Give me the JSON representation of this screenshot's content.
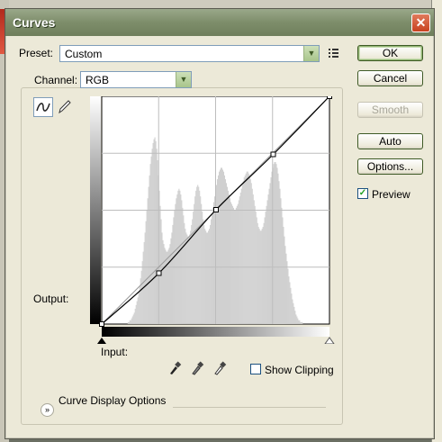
{
  "dialog": {
    "title": "Curves",
    "close_symbol": "✕",
    "preset_label": "Preset:",
    "preset_value": "Custom",
    "preset_menu_icon": "preset-options-icon",
    "channel_label": "Channel:",
    "channel_value": "RGB",
    "output_label": "Output:",
    "input_label": "Input:",
    "show_clipping_label": "Show Clipping",
    "show_clipping_checked": false,
    "curve_display_options_label": "Curve Display Options",
    "preview_label": "Preview",
    "preview_checked": true
  },
  "buttons": {
    "ok": "OK",
    "cancel": "Cancel",
    "smooth": "Smooth",
    "auto": "Auto",
    "options": "Options..."
  },
  "curve": {
    "points": [
      [
        0,
        0
      ],
      [
        64,
        57
      ],
      [
        128,
        128
      ],
      [
        192,
        190
      ],
      [
        255,
        255
      ]
    ]
  },
  "histogram": {
    "bins": [
      0,
      0,
      0,
      0,
      0,
      0,
      0,
      0,
      0,
      0,
      0,
      0,
      0,
      0,
      0,
      0,
      0,
      0,
      0,
      0,
      0,
      0,
      0,
      0,
      0,
      0,
      0,
      0,
      0,
      1,
      1,
      2,
      2,
      3,
      4,
      5,
      6,
      8,
      10,
      12,
      14,
      17,
      20,
      24,
      28,
      33,
      38,
      43,
      48,
      54,
      60,
      66,
      72,
      78,
      84,
      88,
      92,
      95,
      97,
      98,
      96,
      92,
      86,
      78,
      70,
      62,
      55,
      48,
      44,
      42,
      40,
      39,
      38,
      38,
      39,
      40,
      42,
      45,
      48,
      52,
      56,
      60,
      63,
      66,
      68,
      70,
      71,
      70,
      68,
      65,
      61,
      57,
      53,
      50,
      48,
      47,
      46,
      46,
      47,
      49,
      52,
      55,
      59,
      63,
      67,
      70,
      72,
      73,
      72,
      70,
      67,
      63,
      59,
      55,
      52,
      50,
      49,
      48,
      48,
      49,
      50,
      52,
      55,
      58,
      61,
      64,
      67,
      70,
      73,
      76,
      78,
      80,
      81,
      82,
      82,
      81,
      80,
      78,
      76,
      74,
      72,
      70,
      68,
      66,
      64,
      63,
      62,
      61,
      60,
      60,
      61,
      62,
      63,
      65,
      67,
      69,
      71,
      73,
      75,
      77,
      78,
      79,
      80,
      80,
      79,
      78,
      76,
      74,
      71,
      68,
      65,
      62,
      59,
      56,
      53,
      51,
      50,
      49,
      49,
      50,
      51,
      53,
      56,
      59,
      62,
      65,
      68,
      71,
      74,
      77,
      80,
      82,
      84,
      85,
      85,
      84,
      82,
      79,
      75,
      71,
      66,
      61,
      56,
      51,
      46,
      41,
      37,
      33,
      29,
      25,
      22,
      19,
      16,
      13,
      11,
      9,
      7,
      5,
      4,
      3,
      2,
      2,
      1,
      1,
      1,
      0,
      0,
      0,
      0,
      0,
      0,
      0,
      0,
      0,
      0,
      0,
      0,
      0,
      0,
      0,
      0,
      0,
      0,
      0,
      0,
      0,
      0,
      0,
      0,
      0,
      0,
      0,
      0,
      0,
      0,
      0,
      0,
      0,
      0,
      0,
      0,
      0,
      0,
      0,
      0,
      0,
      0,
      0,
      0,
      0,
      0,
      0,
      0,
      0
    ]
  },
  "colors": {
    "titlebar": "#7d8d6a",
    "dialog_bg": "#ece9d8",
    "ok_border": "#3f5b27",
    "histogram": "#d0d0d0"
  }
}
